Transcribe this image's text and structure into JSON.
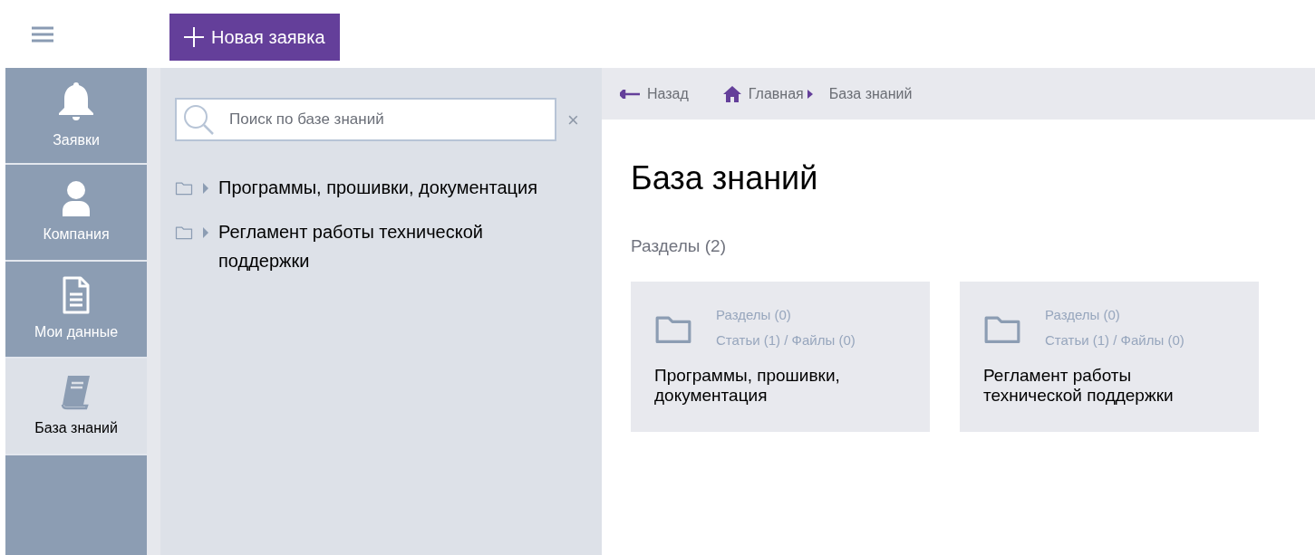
{
  "header": {
    "new_request_button": "Новая заявка"
  },
  "nav": [
    {
      "label": "Заявки",
      "kind": "bell",
      "selected": false
    },
    {
      "label": "Компания",
      "kind": "user",
      "selected": false
    },
    {
      "label": "Мои данные",
      "kind": "document",
      "selected": false
    },
    {
      "label": "База знаний",
      "kind": "book",
      "selected": true
    }
  ],
  "search": {
    "placeholder": "Поиск по базе знаний",
    "clear": "×"
  },
  "tree": [
    {
      "label": "Программы, прошивки, документация",
      "expanded": false
    },
    {
      "label": "Регламент работы технической поддержки",
      "expanded": false
    }
  ],
  "breadcrumb": {
    "back": "Назад",
    "items": [
      "Главная",
      "База знаний"
    ]
  },
  "page_title": "База знаний",
  "sections_heading": "Разделы (2)",
  "cards": [
    {
      "sections": "Разделы (0)",
      "counts": "Статьи (1) / Файлы (0)",
      "title": "Программы, прошивки, документация"
    },
    {
      "sections": "Разделы (0)",
      "counts": "Статьи (1) / Файлы (0)",
      "title": "Регламент работы технической поддержки"
    }
  ]
}
